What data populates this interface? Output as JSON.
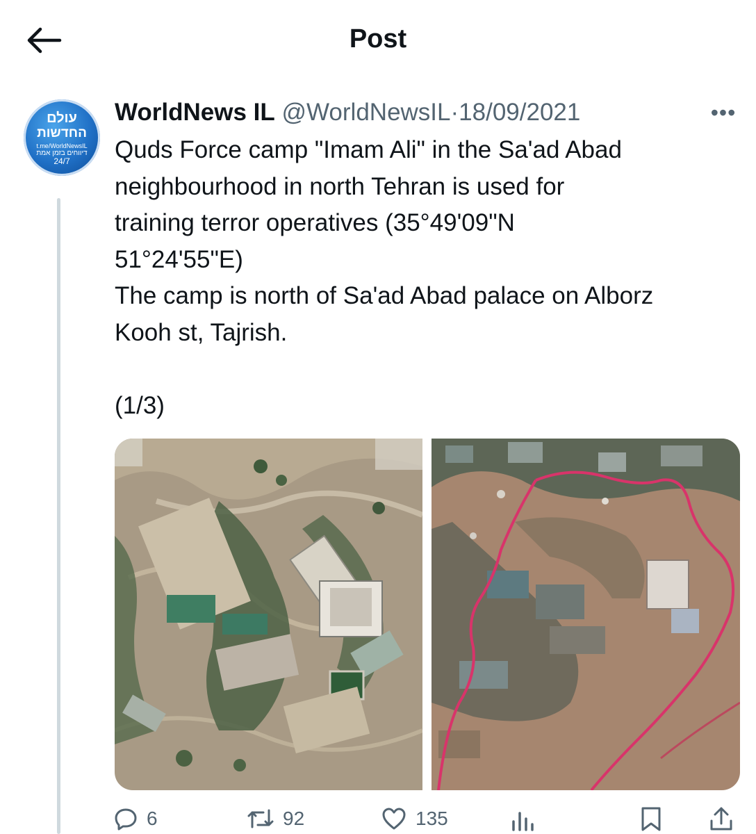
{
  "header": {
    "title": "Post"
  },
  "tweet": {
    "display_name": "WorldNews IL",
    "handle": "@WorldNewsIL",
    "separator": "·",
    "date": "18/09/2021",
    "avatar": {
      "line1": "עולם",
      "line2": "החדשות",
      "line3": "t.me/WorldNewsIL",
      "line4": "דיווחים בזמן אמת",
      "line5": "24/7"
    },
    "text_lines": [
      "Quds Force camp \"Imam Ali\" in the Sa'ad Abad",
      "neighbourhood in north Tehran is used for",
      "training terror operatives (35°49'09\"N",
      "51°24'55\"E)",
      "The camp is north of Sa'ad Abad palace on Alborz",
      "Kooh st, Tajrish.",
      "",
      "(1/3)"
    ]
  },
  "actions": {
    "replies": "6",
    "reposts": "92",
    "likes": "135"
  },
  "icons": {
    "back": "arrow-left-icon",
    "more": "more-dots-icon",
    "reply": "reply-bubble-icon",
    "repost": "repost-icon",
    "like": "heart-icon",
    "views": "analytics-bars-icon",
    "bookmark": "bookmark-icon",
    "share": "share-upload-icon"
  },
  "colors": {
    "text": "#0f1419",
    "secondary": "#536471",
    "thread_line": "#cfd9de",
    "map_route": "#d8346a"
  }
}
